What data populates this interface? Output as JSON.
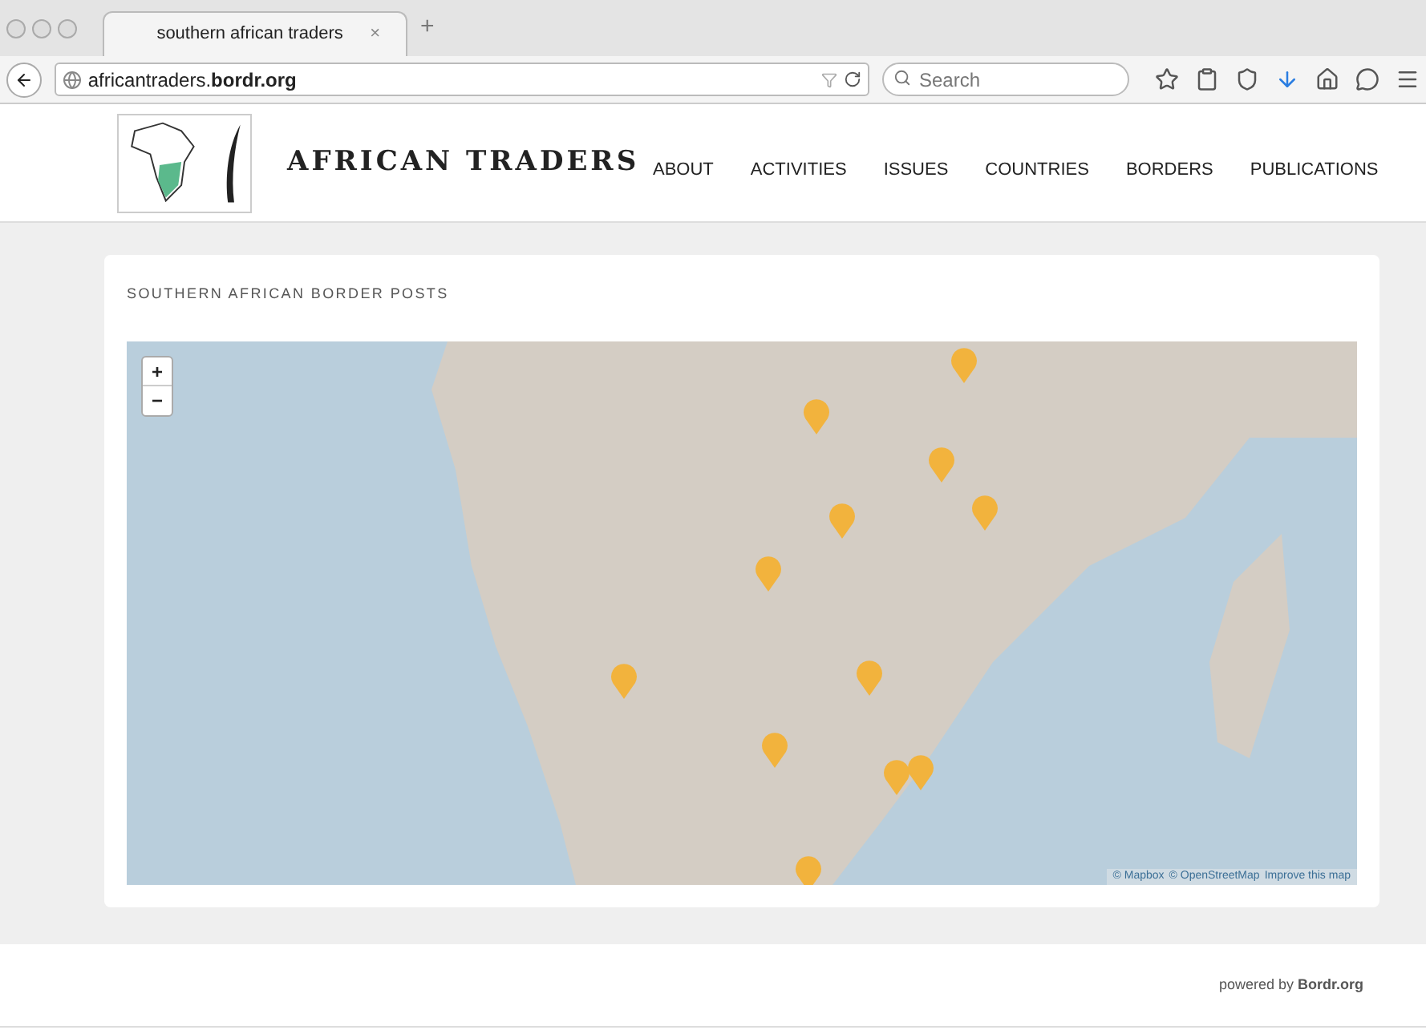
{
  "browser": {
    "tabs": [
      {
        "title": "southern african traders",
        "close": "×",
        "selected": true
      }
    ],
    "new_tab": "+",
    "url": "africantraders.**bordr.org**",
    "search": {
      "placeholder": "Search"
    }
  },
  "site": {
    "title": "AFRICAN TRADERS",
    "nav": [
      {
        "label": "ABOUT",
        "selected": false
      },
      {
        "label": "ACTIVITIES",
        "selected": false
      },
      {
        "label": "ISSUES",
        "selected": false
      },
      {
        "label": "COUNTRIES",
        "selected": false
      },
      {
        "label": "BORDERS",
        "selected": false
      },
      {
        "label": "PUBLICATIONS",
        "selected": false
      }
    ]
  },
  "card": {
    "heading": "SOUTHERN AFRICAN BORDER POSTS",
    "map": {
      "zoom_in": "+",
      "zoom_out": "−",
      "attribution": [
        {
          "label": "© Mapbox"
        },
        {
          "label": "© OpenStreetMap"
        },
        {
          "label": "Improve this map"
        }
      ]
    }
  },
  "footer": {
    "text": "powered by **Bordr.org**"
  }
}
